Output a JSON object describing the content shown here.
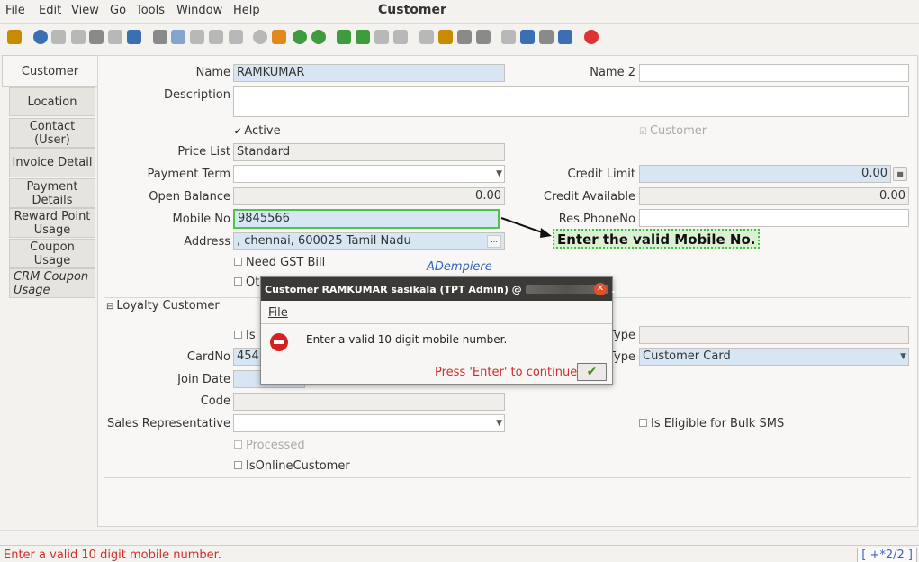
{
  "menubar": {
    "file": "File",
    "edit": "Edit",
    "view": "View",
    "go": "Go",
    "tools": "Tools",
    "window": "Window",
    "help": "Help"
  },
  "window_title": "Customer",
  "tabs": [
    {
      "label": "Customer"
    },
    {
      "label": "Location"
    },
    {
      "label": "Contact (User)"
    },
    {
      "label": "Invoice Detail"
    },
    {
      "label": "Payment Details"
    },
    {
      "label": "Reward Point Usage"
    },
    {
      "label": "Coupon Usage"
    },
    {
      "label": "CRM Coupon Usage"
    }
  ],
  "form": {
    "name_label": "Name",
    "name_value": "RAMKUMAR",
    "name2_label": "Name 2",
    "name2_value": "",
    "description_label": "Description",
    "description_value": "",
    "active_label": "Active",
    "active_checked": true,
    "customer_label": "Customer",
    "customer_checked": true,
    "price_list_label": "Price List",
    "price_list_value": "Standard",
    "payment_term_label": "Payment Term",
    "payment_term_value": "",
    "credit_limit_label": "Credit Limit",
    "credit_limit_value": "0.00",
    "open_balance_label": "Open Balance",
    "open_balance_value": "0.00",
    "credit_available_label": "Credit Available",
    "credit_available_value": "0.00",
    "mobile_label": "Mobile No",
    "mobile_value": "9845566",
    "res_phone_label": "Res.PhoneNo",
    "res_phone_value": "",
    "address_label": "Address",
    "address_value": ", chennai,  600025 Tamil Nadu",
    "need_gst_label": "Need GST Bill",
    "other_label_partial": "Ot",
    "loyalty_section": "Loyalty Customer",
    "is_partial": "Is",
    "type_partial": "Type",
    "card_type_label": "Type",
    "card_type_value": "Customer Card",
    "cardno_label": "CardNo",
    "cardno_value": "454",
    "join_date_label": "Join Date",
    "join_date_value": "",
    "code_label": "Code",
    "code_value": "",
    "sales_rep_label": "Sales Representative",
    "sales_rep_value": "",
    "bulk_sms_label": "Is Eligible for Bulk SMS",
    "processed_label": "Processed",
    "online_label": "IsOnlineCustomer"
  },
  "annotation": {
    "text": "Enter the valid Mobile No."
  },
  "brand": "ADempiere",
  "dialog": {
    "title": "Customer  RAMKUMAR   sasikala (TPT Admin) @",
    "title_suffix": "..",
    "menu_file": "File",
    "message": "Enter a valid 10 digit mobile number.",
    "hint": "Press 'Enter' to continue"
  },
  "statusbar": {
    "message": "Enter a valid 10 digit mobile number.",
    "page_indicator": "[ +*2/2 ]"
  },
  "colors": {
    "error": "#d12c2c",
    "highlight_field": "#d8e6f3",
    "annotation_green": "#3fbf3f"
  }
}
